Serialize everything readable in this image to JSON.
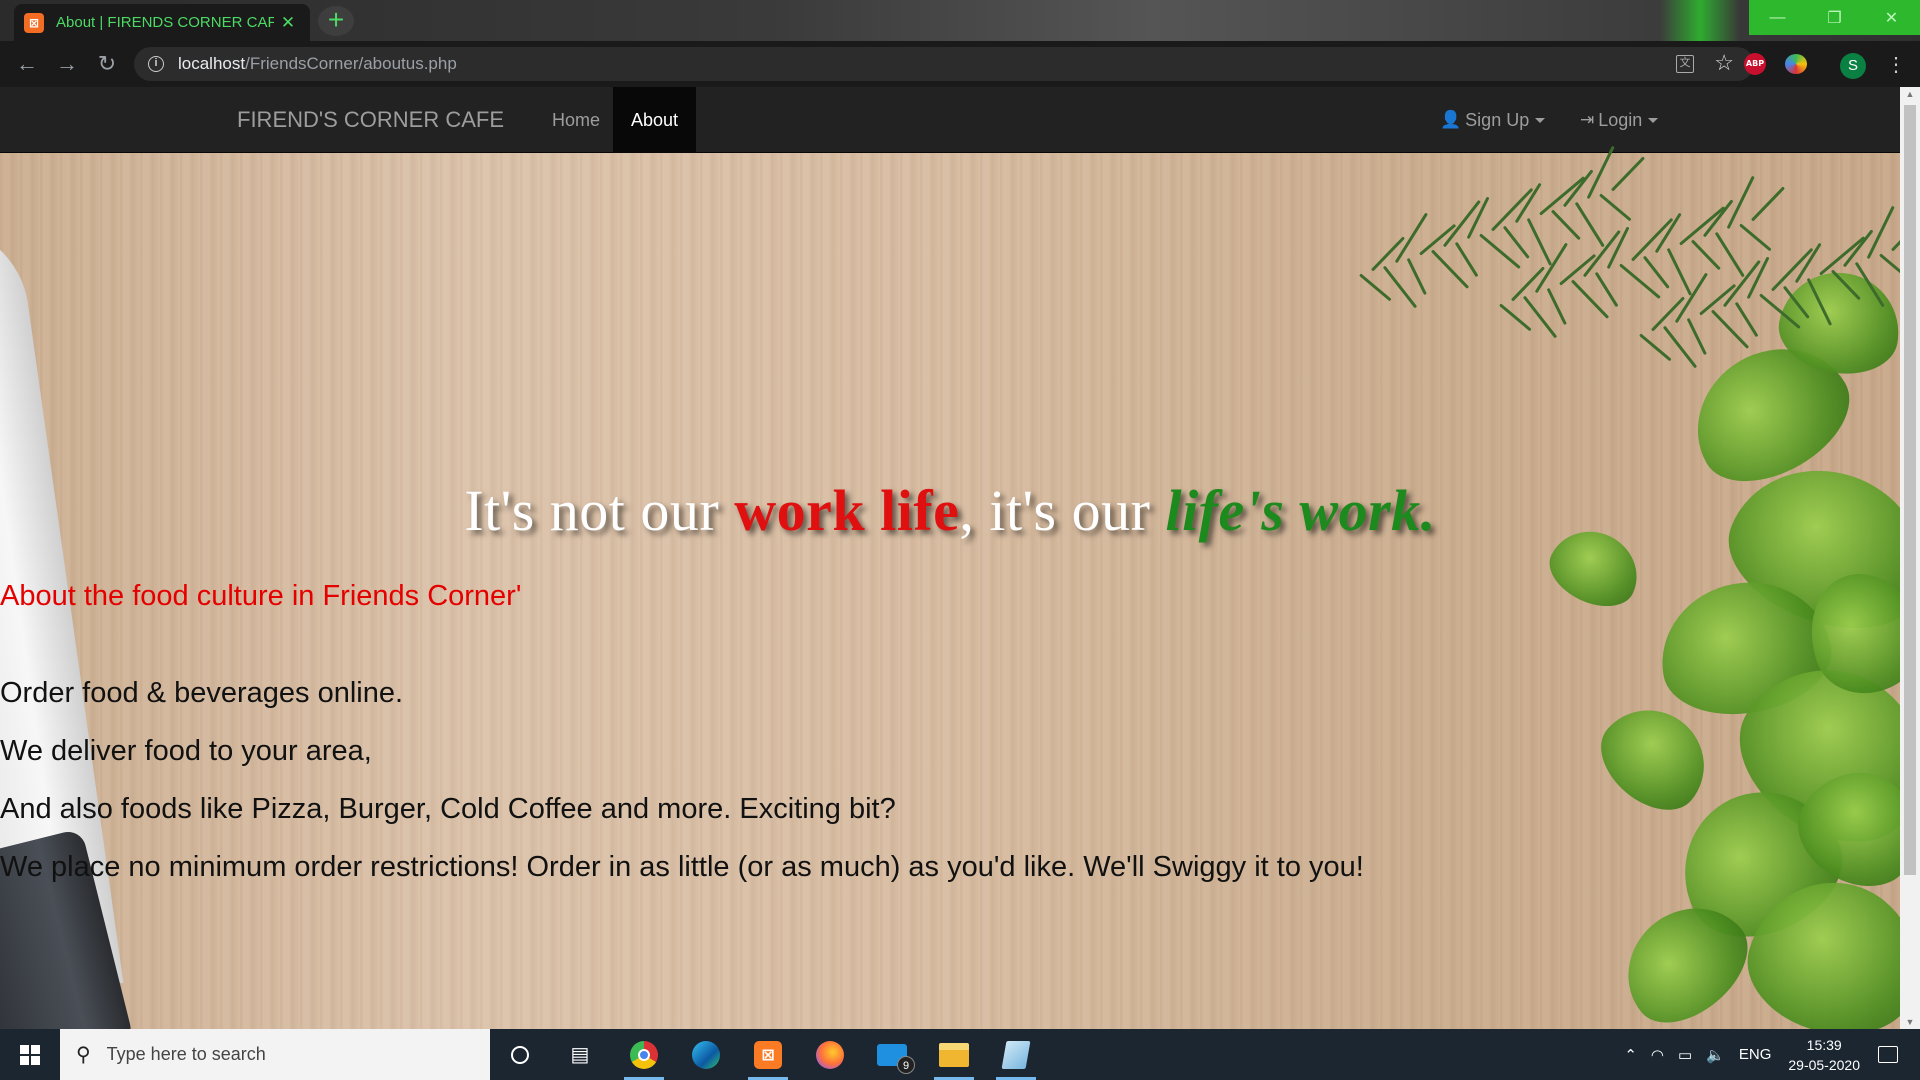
{
  "browser": {
    "tab_title": "About | FIRENDS CORNER CAFE",
    "tab_favicon": "xampp-icon",
    "url_host": "localhost",
    "url_path": "/FriendsCorner/aboutus.php",
    "profile_initial": "S",
    "abp_label": "ABP",
    "nav_icons": [
      "back-arrow-icon",
      "forward-arrow-icon",
      "reload-icon"
    ],
    "accent_color": "#4cd964"
  },
  "navbar": {
    "brand": "FIREND'S CORNER CAFE",
    "items": [
      {
        "label": "Home",
        "active": false
      },
      {
        "label": "About",
        "active": true
      }
    ],
    "right_items": [
      {
        "label": "Sign Up",
        "icon": "user-icon"
      },
      {
        "label": "Login",
        "icon": "login-icon"
      }
    ]
  },
  "hero": {
    "headline": {
      "part1": "It's not our ",
      "part2": "work life",
      "part3": ", it's our ",
      "part4": "life's work",
      "part5": "."
    },
    "about_heading": "About the food culture in Friends Corner'",
    "lines": [
      "Order food & beverages online.",
      "We deliver food to your area,",
      "And also foods like Pizza, Burger, Cold Coffee and more. Exciting bit?",
      "We place no minimum order restrictions! Order in as little (or as much) as you'd like. We'll Swiggy it to you!"
    ],
    "colors": {
      "highlight_red": "#e01010",
      "highlight_green": "#1d8a1d",
      "heading_red": "#e50000"
    }
  },
  "taskbar": {
    "search_placeholder": "Type here to search",
    "mail_badge": "9",
    "language": "ENG",
    "time": "15:39",
    "date": "29-05-2020"
  }
}
